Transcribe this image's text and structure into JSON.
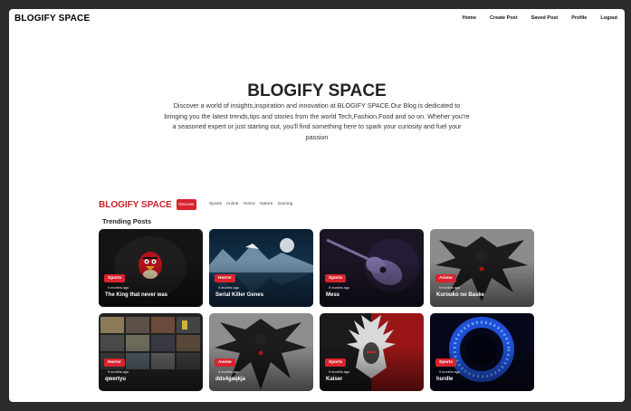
{
  "nav": {
    "brand": "BLOGIFY SPACE",
    "links": [
      "Home",
      "Create Post",
      "Saved Post",
      "Profile",
      "Logout"
    ]
  },
  "hero": {
    "title": "BLOGIFY SPACE",
    "text": "Discover a world of insights,inspiration and innovation at BLOGIFY SPACE.Our Blog is dedicated to bringing you the latest trends,tips and stories from the world Tech,Fashion,Food and so on. Wheher you're a seasoned expert or just starting out, you'll find something here to spark your curiosity and fuel your passion"
  },
  "section": {
    "brand": "BLOGIFY SPACE",
    "discover_label": "Discover",
    "categories": [
      "Sports",
      "Anime",
      "Horror",
      "Nature",
      "Gaming"
    ],
    "heading": "Trending Posts"
  },
  "posts": [
    {
      "category": "Sports",
      "time": "9 months ago",
      "title": "The King that never was",
      "icon": "angry-bird-image"
    },
    {
      "category": "Horror",
      "time": "9 months ago",
      "title": "Serial Killer Genes",
      "icon": "night-lake-moon-image"
    },
    {
      "category": "Sports",
      "time": "9 months ago",
      "title": "Mess",
      "icon": "guitar-image"
    },
    {
      "category": "Anime",
      "time": "9 months ago",
      "title": "Kurouko no Baske",
      "icon": "shinigami-silhouette-image"
    },
    {
      "category": "Horror",
      "time": "9 months ago",
      "title": "qwertyu",
      "icon": "video-grid-image"
    },
    {
      "category": "Anime",
      "time": "9 months ago",
      "title": "dds4gaqkja",
      "icon": "shinigami-silhouette-image"
    },
    {
      "category": "Sports",
      "time": "9 months ago",
      "title": "Kaiser",
      "icon": "feathered-warrior-image"
    },
    {
      "category": "Sports",
      "time": "9 months ago",
      "title": "hurdle",
      "icon": "blue-portal-image"
    }
  ],
  "colors": {
    "accent": "#d9232d",
    "brand_red": "#c81e28",
    "background": "#ffffff",
    "outer": "#2b2b2b"
  }
}
